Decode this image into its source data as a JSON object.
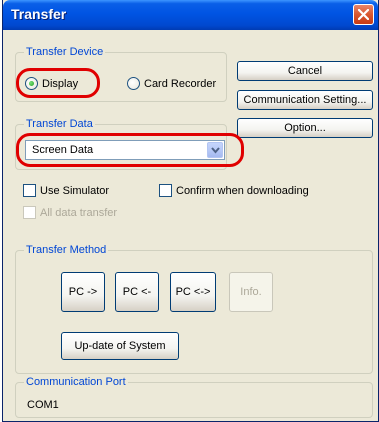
{
  "window": {
    "title": "Transfer"
  },
  "transfer_device": {
    "group_label": "Transfer Device",
    "options": [
      {
        "label": "Display",
        "selected": true
      },
      {
        "label": "Card Recorder",
        "selected": false
      }
    ]
  },
  "transfer_data": {
    "group_label": "Transfer Data",
    "selected_value": "Screen Data"
  },
  "buttons": {
    "cancel": "Cancel",
    "communication_setting": "Communication Setting...",
    "option": "Option..."
  },
  "checkboxes": {
    "use_simulator": "Use Simulator",
    "confirm_downloading": "Confirm when downloading",
    "all_data_transfer": "All data transfer"
  },
  "transfer_method": {
    "group_label": "Transfer Method",
    "pc_to": "PC ->",
    "pc_from": "PC <-",
    "pc_both": "PC <->",
    "info": "Info.",
    "update_system": "Up-date of System"
  },
  "communication_port": {
    "group_label": "Communication Port",
    "value": "COM1"
  },
  "colors": {
    "title_bar": "#0054e3",
    "group_label": "#0046d5",
    "highlight": "#e00000"
  }
}
